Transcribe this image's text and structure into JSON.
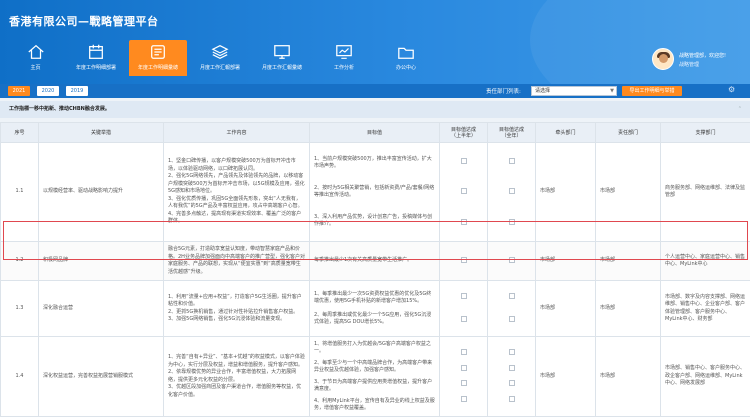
{
  "app_title": "香港有限公司—戰略管理平台",
  "nav": [
    {
      "label": "主页",
      "icon": "home-icon",
      "active": false
    },
    {
      "label": "年度工作明细部署",
      "icon": "calendar-detail-icon",
      "active": false
    },
    {
      "label": "年度工作明細彙總",
      "icon": "summary-board-icon",
      "active": true
    },
    {
      "label": "月度工作汇報部署",
      "icon": "stack-layers-icon",
      "active": false
    },
    {
      "label": "月度工作汇報彙總",
      "icon": "report-monitor-icon",
      "active": false
    },
    {
      "label": "工作分析",
      "icon": "analysis-monitor-icon",
      "active": false
    },
    {
      "label": "办公中心",
      "icon": "office-folder-icon",
      "active": false
    }
  ],
  "user": {
    "greeting": "战略管理部，欢迎您!",
    "role": "战略管理"
  },
  "years": [
    "2021",
    "2020",
    "2019"
  ],
  "filter": {
    "dept_label": "责任部门列表:",
    "dept_value": "请选择",
    "export_label": "导出工作明细与举措"
  },
  "notice": "工作指標一移中拓新、推动CHBN融合发展。",
  "columns": [
    "序号",
    "关键举措",
    "工作内容",
    "目标值",
    "目标值达成\n（上半年）",
    "目标值达成\n（全年）",
    "牵头部门",
    "责任部门",
    "支撑部门"
  ],
  "rows": [
    {
      "no": "1.1",
      "measure": "以规模经营率、驱动战略影响力提升",
      "content": "1、坚金口碑传播，以客户规模突破500万为首标开冲击市场，以体验驱动网络，以口碑拓展认同。\n2、强化5G网络领先，产品领先及体验领先的品牌，以移动客户规模突破500万为首标开冲击市场，以5G规模及应用，强化5G感知和市场地位。\n3、强化优质传播，巩固5G全面领先形象，突出“人无我有，人有我优”的5G产品及丰富权益应用，攻占中高端客户心智。\n4、完善多点触达，提高现有渠道实现效率、覆盖广泛的客户群体。",
      "targets": [
        "1、当前户规模突破500万，推出丰富宣传活动，扩大市场声势。",
        "2、按时为5G相关聚营销，包括新资费/产品/套餐/网络等推出宣传活动。",
        "3、深入利用产品优势，设计创意广告，投稿媒体与创作推介。"
      ],
      "lead": "市场部",
      "resp": "市场部",
      "support": "商务服务部、网络运维部、法律及监管部"
    },
    {
      "no": "1.2",
      "measure": "积极网品牌",
      "content": "融合5G元素，打造助享宽益认知度，带动智慧家庭产品和价格。2H业务品牌加强面向中高端客户的推广营型，强化客户对家庭服务、产品的联想，实现从“便宜实惠”到“高质量宽带生活优越感”升级。",
      "targets": [
        "每季推出最少1次有关高质量宽带生活推广。"
      ],
      "lead": "市场部",
      "resp": "市场部",
      "support": "个人运营中心、家庭运营中心、销售中心、MyLink中心"
    },
    {
      "no": "1.3",
      "measure": "深化融合运营",
      "content": "1、利用“流量+应用+权益”，打造客户5G生活圈，提升客户粘性和价值。\n2、更抓5G换机销售，通过针对性补贴拉升销售客户权益。\n3、加强5G网络销售，强化5G沉浸体验和流量变现。",
      "targets": [
        "1、每季推出最少一次5G资费权益优惠的优化及5G终端优惠，使用5G手机补贴的新增客户增加15%。",
        "2、每周季推出或优化最少一个5G应用，强化5G沉浸式体验，提高5G DOU增长5%。"
      ],
      "lead": "市场部",
      "resp": "市场部",
      "support": "市场部、数字及内容支撑部、网络运维部、销售中心、企业客户部、客户体验管理部、客户服务中心、MyLink中心、财务部"
    },
    {
      "no": "1.4",
      "measure": "深化权益运营，完善权益拓展营销服模式",
      "content": "1、完善“自有+异业”、“基本+优越”的权益模式，以客户体验为中心，实行分层及权益，增益和增值服务，提升客户感知。\n2、依靠规模优势的异业合作，丰富增值权益，大力拓展网络，提供更多元化权益的分层。\n3、优越区段加强商团及客户渠道合作，增值服务等权益，优化客户价值。",
      "targets": [
        "1、将增值服务打入为优越会/5G客户高端客户权益之一。",
        "2、每季至少与一个中高端品牌合作，为高端客户带来异业权益及优越体验，加强客户感知。",
        "3、于节日为高端客户提供应用类增值权益，提升客户满意度。",
        "4、利用MyLink平台，宣传自有及异业的线上权益及服务，增值客户权益覆盖。"
      ],
      "lead": "市场部",
      "resp": "市场部",
      "support": "市场部、销售中心、客户服务中心、政企客户部、网络运维部、MyLink中心、网络发展部"
    }
  ]
}
